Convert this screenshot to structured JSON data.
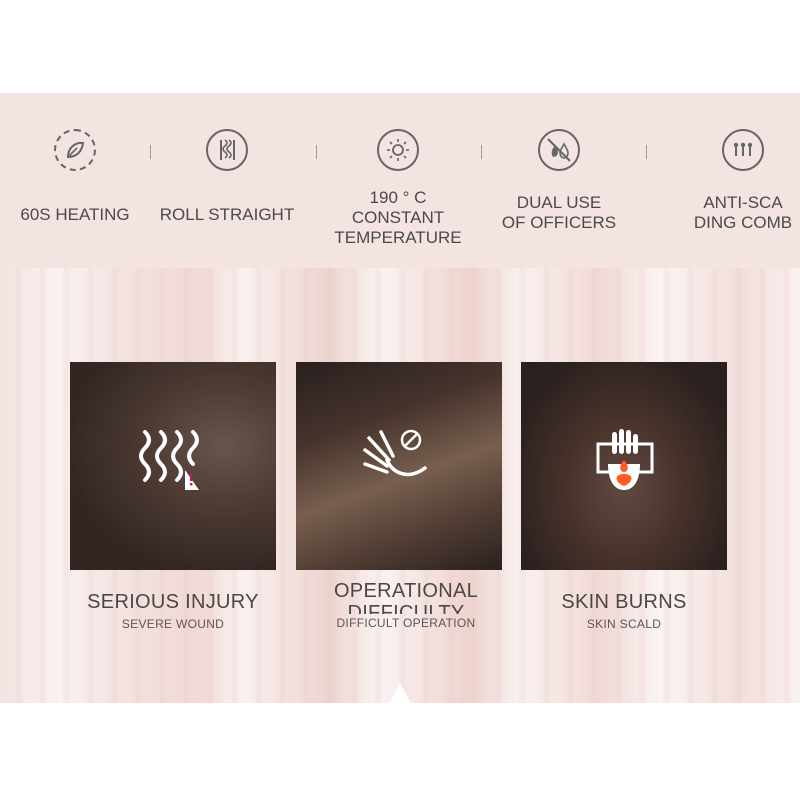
{
  "features": [
    {
      "icon": "heating-leaf-icon",
      "label": "60S HEATING"
    },
    {
      "icon": "roll-straight-icon",
      "label": "ROLL STRAIGHT"
    },
    {
      "icon": "sun-temperature-icon",
      "label_lines": [
        "190 ° C",
        "CONSTANT",
        "TEMPERATURE"
      ]
    },
    {
      "icon": "no-flame-drop-icon",
      "label_lines": [
        "DUAL USE",
        "OF OFFICERS"
      ]
    },
    {
      "icon": "comb-teeth-icon",
      "label_lines": [
        "ANTI-SCA",
        "DING COMB"
      ]
    }
  ],
  "cards": [
    {
      "icon": "damaged-hair-icon",
      "title": "SERIOUS INJURY",
      "subtitle": "SEVERE WOUND"
    },
    {
      "icon": "hand-no-icon",
      "title_lines": [
        "OPERATIONAL",
        "DIFFICULTY"
      ],
      "subtitle": "DIFFICULT OPERATION"
    },
    {
      "icon": "hand-burn-icon",
      "title": "SKIN BURNS",
      "subtitle": "SKIN SCALD"
    }
  ],
  "colors": {
    "banner": "#f3e3e1",
    "text": "#4b4747",
    "icon_stroke": "#666666"
  }
}
